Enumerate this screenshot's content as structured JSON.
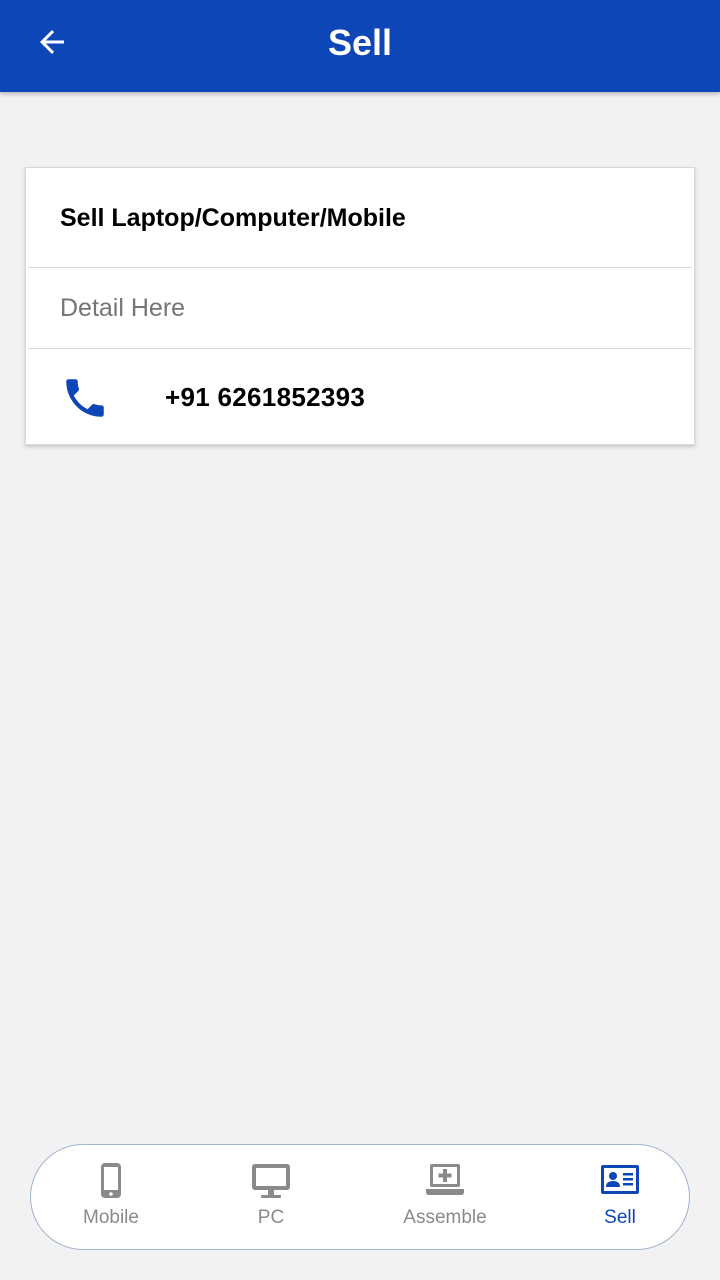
{
  "app_bar": {
    "title": "Sell",
    "back_icon": "arrow-left-icon",
    "background": "#0d47b7"
  },
  "card": {
    "title": "Sell Laptop/Computer/Mobile",
    "detail": "Detail Here",
    "phone_icon": "phone-icon",
    "phone_number": "+91 6261852393"
  },
  "bottom_nav": {
    "active": "Sell",
    "active_color": "#0d47b7",
    "inactive_color": "#8a8a8a",
    "items": [
      {
        "label": "Mobile",
        "icon": "mobile-icon"
      },
      {
        "label": "PC",
        "icon": "monitor-icon"
      },
      {
        "label": "Assemble",
        "icon": "laptop-plus-icon"
      },
      {
        "label": "Sell",
        "icon": "id-card-icon"
      }
    ]
  }
}
